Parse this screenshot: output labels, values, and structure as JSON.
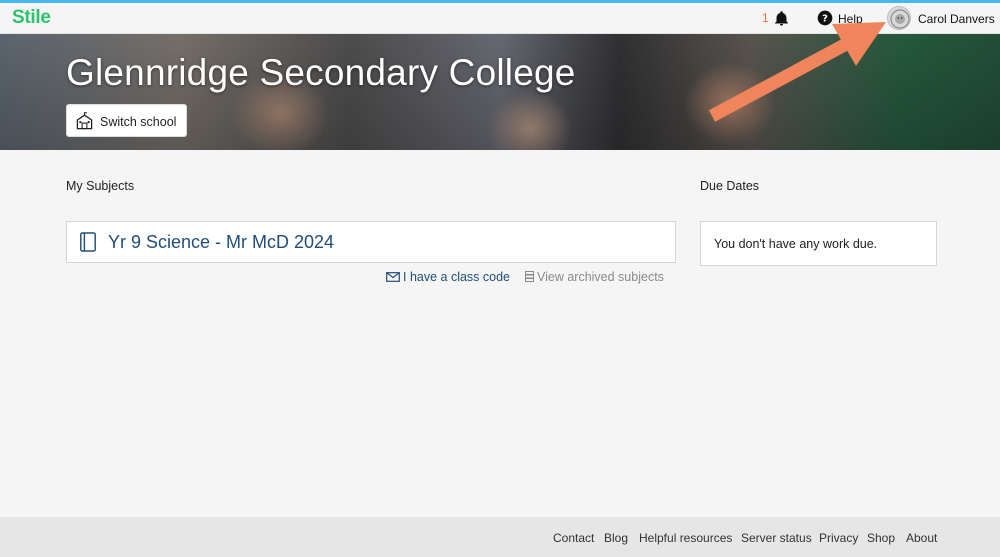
{
  "app": {
    "logo": "Stile"
  },
  "header": {
    "notification_count": "1",
    "help_label": "Help",
    "user_name": "Carol Danvers"
  },
  "banner": {
    "school_name": "Glennridge Secondary College",
    "switch_school_label": "Switch school"
  },
  "subjects": {
    "heading": "My Subjects",
    "items": [
      {
        "label": "Yr 9 Science - Mr McD 2024"
      }
    ],
    "class_code_link": "I have a class code",
    "archived_link": "View archived subjects"
  },
  "due_dates": {
    "heading": "Due Dates",
    "empty_message": "You don't have any work due."
  },
  "footer": {
    "links": [
      "Contact",
      "Blog",
      "Helpful resources",
      "Server status",
      "Privacy",
      "Shop",
      "About"
    ]
  },
  "colors": {
    "brand": "#2fc26a",
    "accent_bar": "#49b8f0",
    "link": "#1f4e79",
    "notification": "#e8722c",
    "annotation_arrow": "#f0845a"
  },
  "icons": {
    "notifications": "bell-icon",
    "help": "question-circle-icon",
    "switch_school": "school-building-icon",
    "subject": "notebook-icon",
    "class_code": "envelope-icon",
    "archived": "archive-icon"
  }
}
